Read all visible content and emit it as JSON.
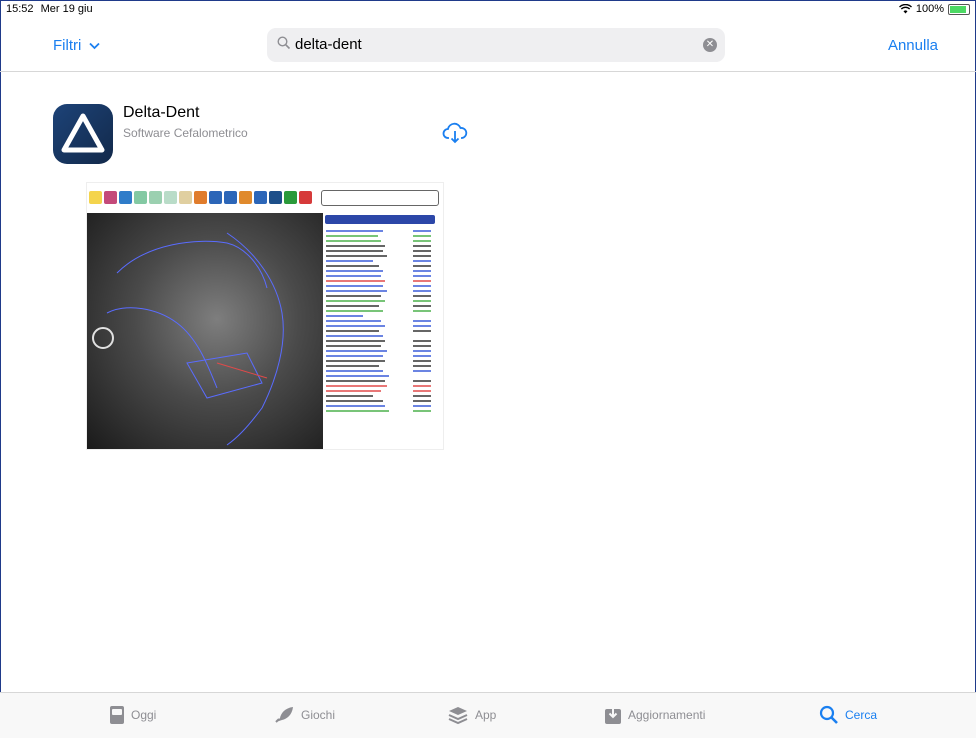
{
  "status_bar": {
    "time": "15:52",
    "date": "Mer 19 giu",
    "battery": "100%"
  },
  "navbar": {
    "filters_label": "Filtri",
    "search_value": "delta-dent",
    "cancel_label": "Annulla"
  },
  "result": {
    "app_name": "Delta-Dent",
    "subtitle": "Software Cefalometrico",
    "download_icon": "cloud-download-icon"
  },
  "tabs": [
    {
      "label": "Oggi",
      "icon": "today-icon",
      "active": false
    },
    {
      "label": "Giochi",
      "icon": "rocket-icon",
      "active": false
    },
    {
      "label": "App",
      "icon": "layers-icon",
      "active": false
    },
    {
      "label": "Aggiornamenti",
      "icon": "download-tray-icon",
      "active": false
    },
    {
      "label": "Cerca",
      "icon": "search-icon",
      "active": true
    }
  ],
  "colors": {
    "accent": "#1a7ff0",
    "gray": "#8e8e93"
  }
}
